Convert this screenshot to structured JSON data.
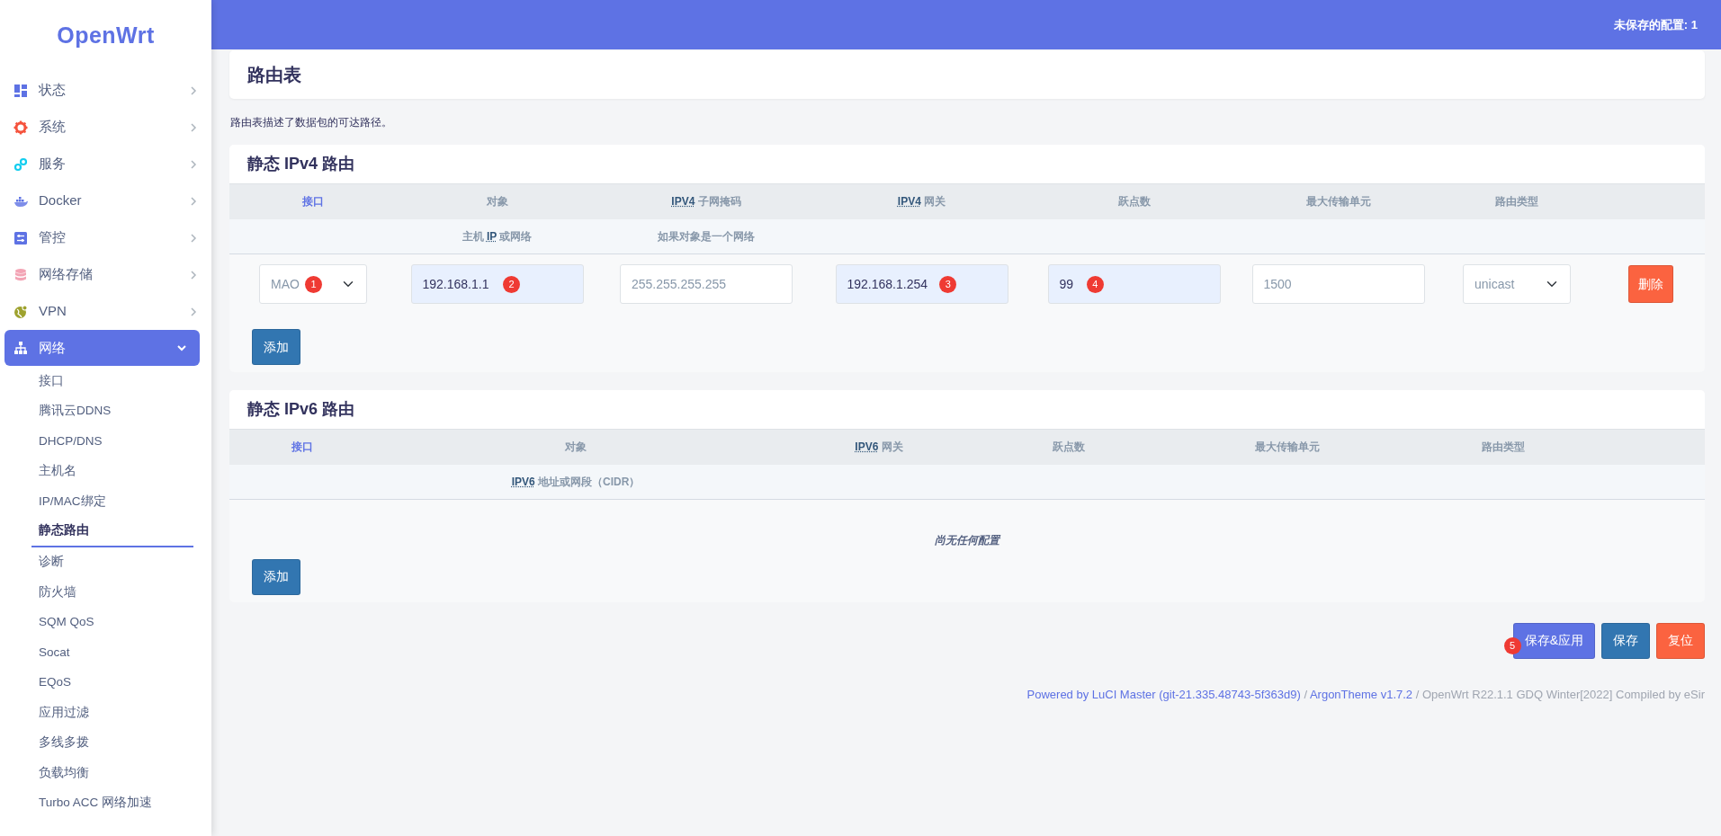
{
  "topbar": {
    "unsaved": "未保存的配置: 1"
  },
  "sidebar": {
    "logo": "OpenWrt",
    "items": [
      {
        "label": "状态",
        "expanded": false,
        "selected": false
      },
      {
        "label": "系统",
        "expanded": false,
        "selected": false
      },
      {
        "label": "服务",
        "expanded": false,
        "selected": false
      },
      {
        "label": "Docker",
        "expanded": false,
        "selected": false
      },
      {
        "label": "管控",
        "expanded": false,
        "selected": false
      },
      {
        "label": "网络存储",
        "expanded": false,
        "selected": false
      },
      {
        "label": "VPN",
        "expanded": false,
        "selected": false
      },
      {
        "label": "网络",
        "expanded": true,
        "selected": true,
        "children": [
          {
            "label": "接口",
            "selected": false
          },
          {
            "label": "腾讯云DDNS",
            "selected": false
          },
          {
            "label": "DHCP/DNS",
            "selected": false
          },
          {
            "label": "主机名",
            "selected": false
          },
          {
            "label": "IP/MAC绑定",
            "selected": false
          },
          {
            "label": "静态路由",
            "selected": true
          },
          {
            "label": "诊断",
            "selected": false
          },
          {
            "label": "防火墙",
            "selected": false
          },
          {
            "label": "SQM QoS",
            "selected": false
          },
          {
            "label": "Socat",
            "selected": false
          },
          {
            "label": "EQoS",
            "selected": false
          },
          {
            "label": "应用过滤",
            "selected": false
          },
          {
            "label": "多线多拨",
            "selected": false
          },
          {
            "label": "负载均衡",
            "selected": false
          },
          {
            "label": "Turbo ACC 网络加速",
            "selected": false
          }
        ]
      }
    ]
  },
  "page": {
    "title": "路由表",
    "description": "路由表描述了数据包的可达路径。"
  },
  "ipv4": {
    "title": "静态 IPv4 路由",
    "columns": [
      {
        "label": "接口",
        "link": true
      },
      {
        "label": "对象",
        "link": false,
        "hint": {
          "before": "主机",
          "abbr": "IP",
          "after": "或网络"
        }
      },
      {
        "abbr": "IPV4",
        "label": "子网掩码",
        "link": false,
        "hint": {
          "before": "如果对象是一个网络"
        }
      },
      {
        "abbr": "IPV4",
        "label": "网关",
        "link": false
      },
      {
        "label": "跃点数",
        "link": false
      },
      {
        "label": "最大传输单元",
        "link": false
      },
      {
        "label": "路由类型",
        "link": false
      }
    ],
    "rows": [
      {
        "interface": {
          "value": "MAO",
          "callout": "1"
        },
        "target": {
          "value": "192.168.1.1",
          "autofilled": true,
          "callout": "2"
        },
        "netmask": {
          "placeholder": "255.255.255.255",
          "autofilled": false
        },
        "gateway": {
          "value": "192.168.1.254",
          "autofilled": true,
          "callout": "3"
        },
        "metric": {
          "value": "99",
          "autofilled": true,
          "callout": "4"
        },
        "mtu": {
          "placeholder": "1500",
          "autofilled": false
        },
        "type": {
          "value": "unicast"
        },
        "delete": "删除"
      }
    ],
    "add": "添加"
  },
  "ipv6": {
    "title": "静态 IPv6 路由",
    "columns": [
      {
        "label": "接口",
        "link": true
      },
      {
        "label": "对象",
        "link": false,
        "hint": {
          "abbr": "IPV6",
          "after": "地址或网段（CIDR）"
        }
      },
      {
        "abbr": "IPV6",
        "label": "网关",
        "link": false
      },
      {
        "label": "跃点数",
        "link": false
      },
      {
        "label": "最大传输单元",
        "link": false
      },
      {
        "label": "路由类型",
        "link": false
      }
    ],
    "empty": "尚无任何配置",
    "add": "添加"
  },
  "actions": [
    {
      "label": "保存&应用",
      "kind": "apply",
      "callout": "5"
    },
    {
      "label": "保存",
      "kind": "save"
    },
    {
      "label": "复位",
      "kind": "reset"
    }
  ],
  "footer": {
    "parts": [
      {
        "text": "Powered by LuCI Master (git-21.335.48743-5f363d9)",
        "link": true
      },
      {
        "text": " / ",
        "link": false
      },
      {
        "text": "ArgonTheme v1.7.2",
        "link": true
      },
      {
        "text": " / OpenWrt R22.1.1 GDQ Winter[2022] Compiled by eSir",
        "link": false
      }
    ]
  }
}
